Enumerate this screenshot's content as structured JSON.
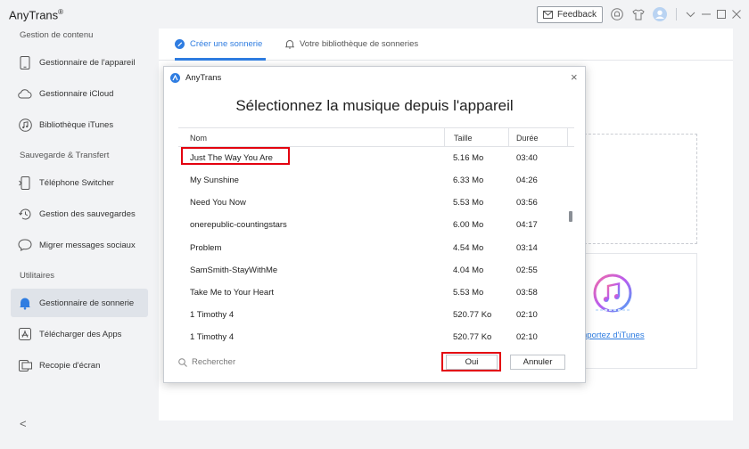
{
  "app": {
    "name": "AnyTrans",
    "reg": "®"
  },
  "titlebar": {
    "feedback_label": "Feedback"
  },
  "sidebar": {
    "sections": [
      {
        "title": "Gestion de contenu"
      },
      {
        "title": "Sauvegarde & Transfert"
      },
      {
        "title": "Utilitaires"
      }
    ],
    "items": [
      {
        "label": "Gestionnaire de l'appareil"
      },
      {
        "label": "Gestionnaire iCloud"
      },
      {
        "label": "Bibliothèque iTunes"
      },
      {
        "label": "Téléphone Switcher"
      },
      {
        "label": "Gestion des sauvegardes"
      },
      {
        "label": "Migrer messages sociaux"
      },
      {
        "label": "Gestionnaire de sonnerie"
      },
      {
        "label": "Télécharger des Apps"
      },
      {
        "label": "Recopie d'écran"
      }
    ],
    "collapse_label": "<"
  },
  "main": {
    "tabs": [
      {
        "label": "Créer une sonnerie"
      },
      {
        "label": "Votre bibliothèque de sonneries"
      }
    ],
    "bg_arrow": ">",
    "itunes_link": "nportez d'iTunes"
  },
  "dialog": {
    "header": "AnyTrans",
    "title": "Sélectionnez la musique depuis l'appareil",
    "columns": {
      "name": "Nom",
      "size": "Taille",
      "duration": "Durée"
    },
    "rows": [
      {
        "name": "Just The Way You Are",
        "size": "5.16 Mo",
        "duration": "03:40"
      },
      {
        "name": "My Sunshine",
        "size": "6.33 Mo",
        "duration": "04:26"
      },
      {
        "name": "Need You Now",
        "size": "5.53 Mo",
        "duration": "03:56"
      },
      {
        "name": "onerepublic-countingstars",
        "size": "6.00 Mo",
        "duration": "04:17"
      },
      {
        "name": "Problem",
        "size": "4.54 Mo",
        "duration": "03:14"
      },
      {
        "name": "SamSmith-StayWithMe",
        "size": "4.04 Mo",
        "duration": "02:55"
      },
      {
        "name": "Take Me to Your Heart",
        "size": "5.53 Mo",
        "duration": "03:58"
      },
      {
        "name": "1 Timothy 4",
        "size": "520.77 Ko",
        "duration": "02:10"
      },
      {
        "name": "1 Timothy 4",
        "size": "520.77 Ko",
        "duration": "02:10"
      }
    ],
    "search_placeholder": "Rechercher",
    "ok_label": "Oui",
    "cancel_label": "Annuler",
    "close_label": "×"
  },
  "colors": {
    "accent": "#2f7de1",
    "highlight": "#e3000f"
  }
}
